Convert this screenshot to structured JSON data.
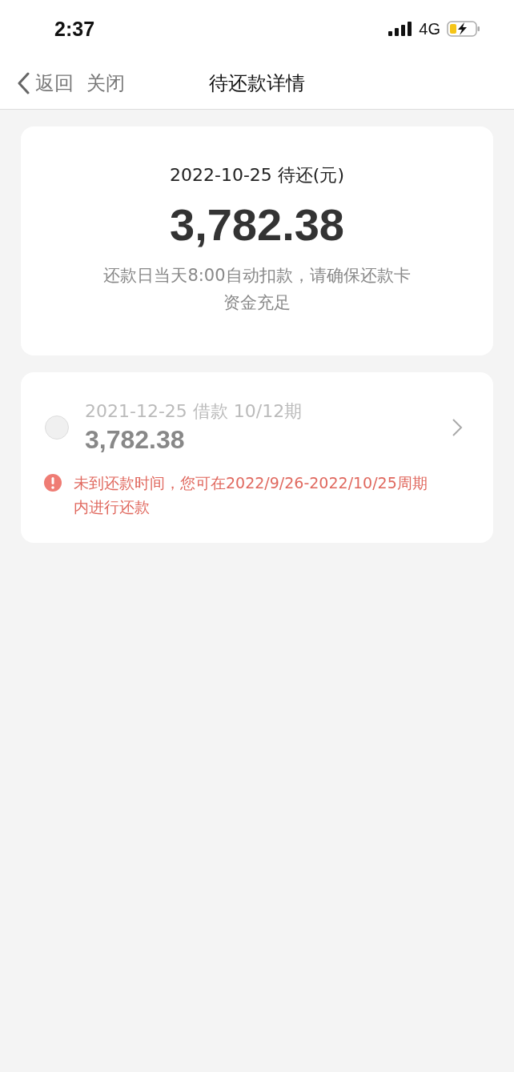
{
  "status_bar": {
    "time": "2:37",
    "network": "4G"
  },
  "nav": {
    "back": "返回",
    "close": "关闭",
    "title": "待还款详情"
  },
  "summary": {
    "heading": "2022-10-25 待还(元)",
    "amount": "3,782.38",
    "note": "还款日当天8:00自动扣款，请确保还款卡资金充足"
  },
  "bills": [
    {
      "date_info": "2021-12-25 借款 10/12期",
      "amount": "3,782.38",
      "selected": false,
      "disabled": true,
      "warning": "未到还款时间，您可在2022/9/26-2022/10/25周期内进行还款"
    }
  ]
}
